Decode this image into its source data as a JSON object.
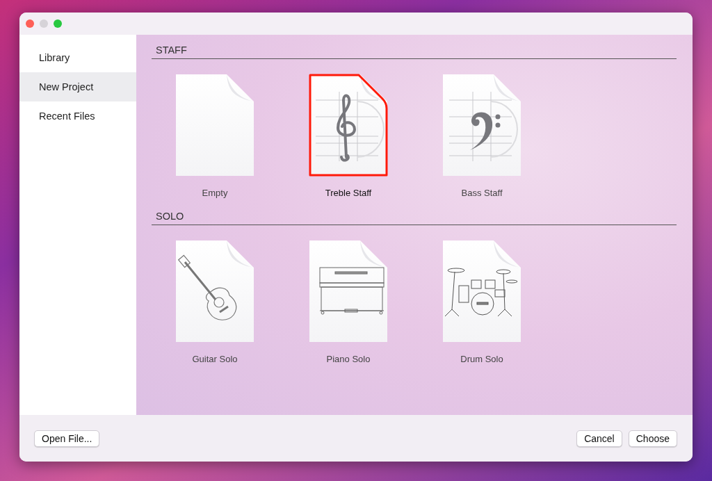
{
  "sidebar": {
    "items": [
      {
        "label": "Library",
        "selected": false
      },
      {
        "label": "New Project",
        "selected": true
      },
      {
        "label": "Recent Files",
        "selected": false
      }
    ]
  },
  "sections": [
    {
      "title": "STAFF",
      "templates": [
        {
          "label": "Empty",
          "kind": "empty",
          "selected": false
        },
        {
          "label": "Treble Staff",
          "kind": "treble",
          "selected": true
        },
        {
          "label": "Bass Staff",
          "kind": "bass",
          "selected": false
        }
      ]
    },
    {
      "title": "SOLO",
      "templates": [
        {
          "label": "Guitar Solo",
          "kind": "guitar",
          "selected": false
        },
        {
          "label": "Piano Solo",
          "kind": "piano",
          "selected": false
        },
        {
          "label": "Drum Solo",
          "kind": "drum",
          "selected": false
        }
      ]
    }
  ],
  "footer": {
    "left_button": "Open File...",
    "right_buttons": [
      "Cancel",
      "Choose"
    ]
  }
}
